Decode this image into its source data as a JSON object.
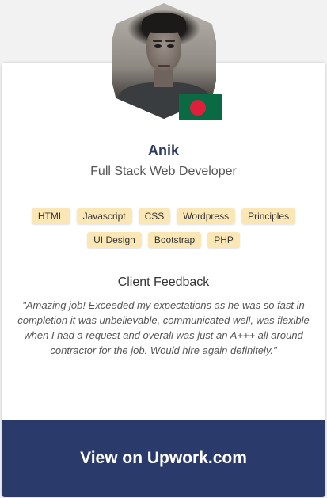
{
  "profile": {
    "name": "Anik",
    "role": "Full Stack Web Developer",
    "avatar": "profile-photo",
    "flag": "bangladesh-flag-icon"
  },
  "skills": [
    "HTML",
    "Javascript",
    "CSS",
    "Wordpress",
    "Principles",
    "UI Design",
    "Bootstrap",
    "PHP"
  ],
  "feedback": {
    "title": "Client Feedback",
    "text": "\"Amazing job! Exceeded my expectations as he was so fast in completion it was unbelievable, communicated well, was flexible when I had a request and overall was just an A+++ all around contractor for the job. Would hire again definitely.\""
  },
  "cta": {
    "label": "View on Upwork.com"
  },
  "colors": {
    "accent": "#2a3a6b",
    "tag_bg": "#fbe7b6",
    "flag_green": "#0a6a43",
    "flag_red": "#e0203a"
  }
}
